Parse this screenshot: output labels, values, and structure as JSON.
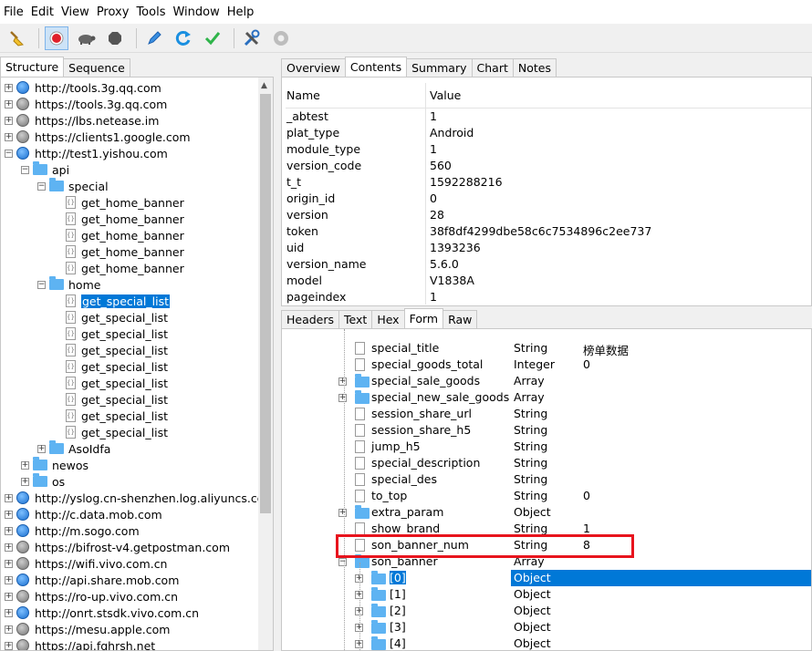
{
  "menu": [
    "File",
    "Edit",
    "View",
    "Proxy",
    "Tools",
    "Window",
    "Help"
  ],
  "left_tabs": [
    "Structure",
    "Sequence"
  ],
  "right_tabs": [
    "Overview",
    "Contents",
    "Summary",
    "Chart",
    "Notes"
  ],
  "sub_tabs": [
    "Headers",
    "Text",
    "Hex",
    "Form",
    "Raw"
  ],
  "tree": [
    {
      "label": "http://tools.3g.qq.com",
      "icon": "globe"
    },
    {
      "label": "https://tools.3g.qq.com",
      "icon": "lock"
    },
    {
      "label": "https://lbs.netease.im",
      "icon": "lock"
    },
    {
      "label": "https://clients1.google.com",
      "icon": "lock"
    },
    {
      "label": "http://test1.yishou.com",
      "icon": "globe"
    },
    {
      "label": "api",
      "icon": "folder"
    },
    {
      "label": "special",
      "icon": "folder"
    },
    {
      "label": "get_home_banner",
      "icon": "doc"
    },
    {
      "label": "get_home_banner",
      "icon": "doc"
    },
    {
      "label": "get_home_banner",
      "icon": "doc"
    },
    {
      "label": "get_home_banner",
      "icon": "doc"
    },
    {
      "label": "get_home_banner",
      "icon": "doc"
    },
    {
      "label": "home",
      "icon": "folder"
    },
    {
      "label": "get_special_list",
      "icon": "doc"
    },
    {
      "label": "get_special_list",
      "icon": "doc"
    },
    {
      "label": "get_special_list",
      "icon": "doc"
    },
    {
      "label": "get_special_list",
      "icon": "doc"
    },
    {
      "label": "get_special_list",
      "icon": "doc"
    },
    {
      "label": "get_special_list",
      "icon": "doc"
    },
    {
      "label": "get_special_list",
      "icon": "doc"
    },
    {
      "label": "get_special_list",
      "icon": "doc"
    },
    {
      "label": "get_special_list",
      "icon": "doc"
    },
    {
      "label": "AsoIdfa",
      "icon": "folder"
    },
    {
      "label": "newos",
      "icon": "folder"
    },
    {
      "label": "os",
      "icon": "folder"
    },
    {
      "label": "http://yslog.cn-shenzhen.log.aliyuncs.com",
      "icon": "globe"
    },
    {
      "label": "http://c.data.mob.com",
      "icon": "globe"
    },
    {
      "label": "http://m.sogo.com",
      "icon": "globe"
    },
    {
      "label": "https://bifrost-v4.getpostman.com",
      "icon": "lock"
    },
    {
      "label": "https://wifi.vivo.com.cn",
      "icon": "lock"
    },
    {
      "label": "http://api.share.mob.com",
      "icon": "globe"
    },
    {
      "label": "https://ro-up.vivo.com.cn",
      "icon": "lock"
    },
    {
      "label": "http://onrt.stsdk.vivo.com.cn",
      "icon": "globe"
    },
    {
      "label": "https://mesu.apple.com",
      "icon": "lock"
    },
    {
      "label": "https://api.fghrsh.net",
      "icon": "lock"
    }
  ],
  "grid": {
    "headers": [
      "Name",
      "Value"
    ],
    "rows": [
      [
        "_abtest",
        "1"
      ],
      [
        "plat_type",
        "Android"
      ],
      [
        "module_type",
        "1"
      ],
      [
        "version_code",
        "560"
      ],
      [
        "t_t",
        "1592288216"
      ],
      [
        "origin_id",
        "0"
      ],
      [
        "version",
        "28"
      ],
      [
        "token",
        "38f8df4299dbe58c6c7534896c2ee737"
      ],
      [
        "uid",
        "1393236"
      ],
      [
        "version_name",
        "5.6.0"
      ],
      [
        "model",
        "V1838A"
      ],
      [
        "pageindex",
        "1"
      ]
    ]
  },
  "form_rows": [
    {
      "name": "special_title",
      "type": "String",
      "value": "榜单数据",
      "icon": "doc"
    },
    {
      "name": "special_goods_total",
      "type": "Integer",
      "value": "0",
      "icon": "doc"
    },
    {
      "name": "special_sale_goods",
      "type": "Array",
      "value": "",
      "icon": "folder"
    },
    {
      "name": "special_new_sale_goods",
      "type": "Array",
      "value": "",
      "icon": "folder"
    },
    {
      "name": "session_share_url",
      "type": "String",
      "value": "",
      "icon": "doc"
    },
    {
      "name": "session_share_h5",
      "type": "String",
      "value": "",
      "icon": "doc"
    },
    {
      "name": "jump_h5",
      "type": "String",
      "value": "",
      "icon": "doc"
    },
    {
      "name": "special_description",
      "type": "String",
      "value": "",
      "icon": "doc"
    },
    {
      "name": "special_des",
      "type": "String",
      "value": "",
      "icon": "doc"
    },
    {
      "name": "to_top",
      "type": "String",
      "value": "0",
      "icon": "doc"
    },
    {
      "name": "extra_param",
      "type": "Object",
      "value": "",
      "icon": "folder"
    },
    {
      "name": "show_brand",
      "type": "String",
      "value": "1",
      "icon": "doc"
    },
    {
      "name": "son_banner_num",
      "type": "String",
      "value": "8",
      "icon": "doc"
    },
    {
      "name": "son_banner",
      "type": "Array",
      "value": "",
      "icon": "folder"
    },
    {
      "name": "[0]",
      "type": "Object",
      "value": "",
      "icon": "folder"
    },
    {
      "name": "[1]",
      "type": "Object",
      "value": "",
      "icon": "folder"
    },
    {
      "name": "[2]",
      "type": "Object",
      "value": "",
      "icon": "folder"
    },
    {
      "name": "[3]",
      "type": "Object",
      "value": "",
      "icon": "folder"
    },
    {
      "name": "[4]",
      "type": "Object",
      "value": "",
      "icon": "folder"
    }
  ],
  "colors": {
    "selection": "#0078d7",
    "highlight_box": "#e8141d"
  }
}
